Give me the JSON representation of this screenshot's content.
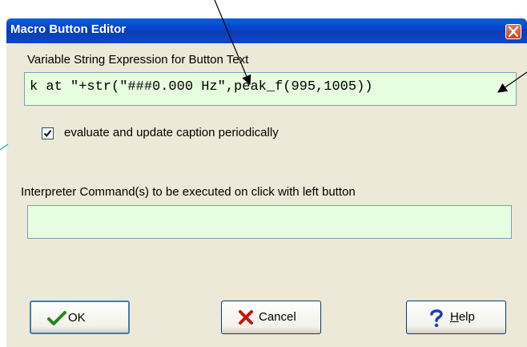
{
  "window": {
    "title": "Macro Button Editor"
  },
  "expression": {
    "label": "Variable String Expression for Button Text",
    "value": "k at \"+str(\"###0.000 Hz\",peak_f(995,1005))"
  },
  "periodic_update": {
    "label": "evaluate and update caption periodically",
    "checked": true
  },
  "command": {
    "label": "Interpreter Command(s) to be executed on click with  left  button",
    "value": ""
  },
  "buttons": {
    "ok": "OK",
    "cancel": "Cancel",
    "help_underlined": "H",
    "help_rest": "elp"
  },
  "icons": {
    "ok": "checkmark-icon",
    "cancel": "x-icon",
    "help": "question-icon",
    "close": "close-icon"
  },
  "colors": {
    "title_bar": "#0840c8",
    "input_bg": "#e6fde0",
    "dialog_bg": "#ece9d8",
    "ok_icon": "#1f8a1f",
    "cancel_icon": "#c0180c",
    "help_icon": "#1a3fb0"
  }
}
